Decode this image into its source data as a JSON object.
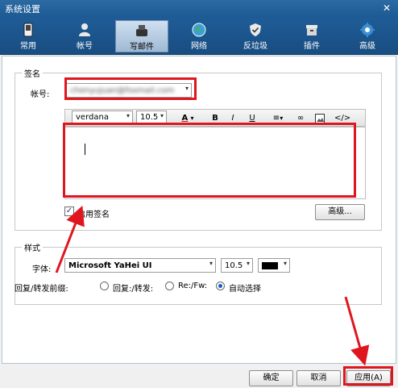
{
  "window": {
    "title": "系统设置",
    "close_glyph": "✕"
  },
  "tabs": [
    {
      "label": "常用",
      "icon": "phone-icon"
    },
    {
      "label": "帐号",
      "icon": "user-icon"
    },
    {
      "label": "写邮件",
      "icon": "compose-icon",
      "active": true
    },
    {
      "label": "网络",
      "icon": "globe-icon"
    },
    {
      "label": "反垃圾",
      "icon": "shield-icon"
    },
    {
      "label": "插件",
      "icon": "box-icon"
    },
    {
      "label": "高级",
      "icon": "gear-icon"
    }
  ],
  "signature": {
    "group_title": "签名",
    "account_label": "帐号:",
    "account_value": "chenyujuan@foxmail.com",
    "font_value": "verdana",
    "size_value": "10.5",
    "font_color_glyph": "A",
    "bold_glyph": "B",
    "italic_glyph": "I",
    "underline_glyph": "U",
    "enable_label": "启用签名",
    "advanced_button": "高级..."
  },
  "style": {
    "group_title": "样式",
    "font_label": "字体:",
    "font_value": "Microsoft YaHei UI",
    "size_value": "10.5",
    "prefix_label": "回复/转发前缀:",
    "options": [
      "回复:/转发:",
      "Re:/Fw:",
      "自动选择"
    ],
    "selected_option": "自动选择"
  },
  "footer": {
    "ok": "确定",
    "cancel": "取消",
    "apply": "应用(A)"
  },
  "colors": {
    "accent": "#1f5c97",
    "highlight": "#e0161f",
    "text_color_swatch": "#000000"
  }
}
